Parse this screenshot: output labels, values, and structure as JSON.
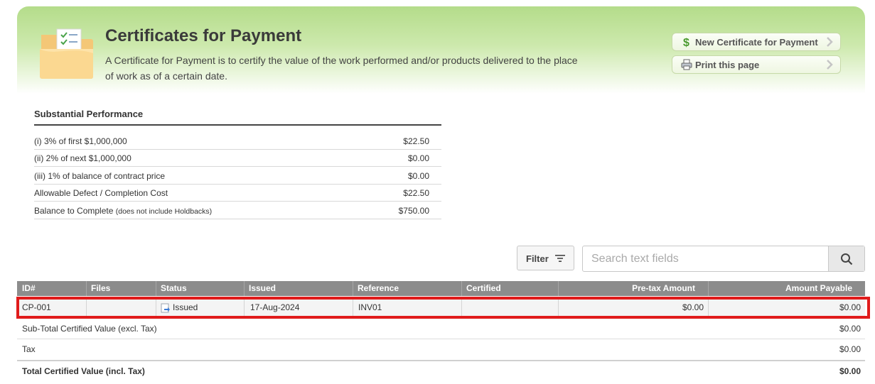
{
  "header": {
    "title": "Certificates for Payment",
    "description": "A Certificate for Payment is to certify the value of the work performed and/or products delivered to the place of work as of a certain date.",
    "buttons": {
      "new_certificate": "New Certificate for Payment",
      "print_page": "Print this page"
    },
    "colors": {
      "banner_green": "#b4dc8a",
      "dollar_green": "#4a9a2e"
    }
  },
  "substantial_performance": {
    "title": "Substantial Performance",
    "rows": [
      {
        "label": "(i) 3% of first $1,000,000",
        "value": "$22.50"
      },
      {
        "label": "(ii) 2% of next $1,000,000",
        "value": "$0.00"
      },
      {
        "label": "(iii) 1% of balance of contract price",
        "value": "$0.00"
      },
      {
        "label": "Allowable Defect / Completion Cost",
        "value": "$22.50"
      },
      {
        "label": "Balance to Complete",
        "note": "(does not include Holdbacks)",
        "value": "$750.00"
      }
    ]
  },
  "toolbar": {
    "filter_label": "Filter",
    "search_placeholder": "Search text fields"
  },
  "table": {
    "columns": [
      "ID#",
      "Files",
      "Status",
      "Issued",
      "Reference",
      "Certified",
      "Pre-tax Amount",
      "Amount Payable"
    ],
    "rows": [
      {
        "id": "CP-001",
        "files": "",
        "status": "Issued",
        "issued": "17-Aug-2024",
        "reference": "INV01",
        "certified": "",
        "pretax": "$0.00",
        "payable": "$0.00"
      }
    ],
    "highlight_color": "#e01b1b"
  },
  "summary": {
    "subtotal_label": "Sub-Total Certified Value (excl. Tax)",
    "subtotal_value": "$0.00",
    "tax_label": "Tax",
    "tax_value": "$0.00",
    "total_label": "Total Certified Value (incl. Tax)",
    "total_value": "$0.00"
  }
}
